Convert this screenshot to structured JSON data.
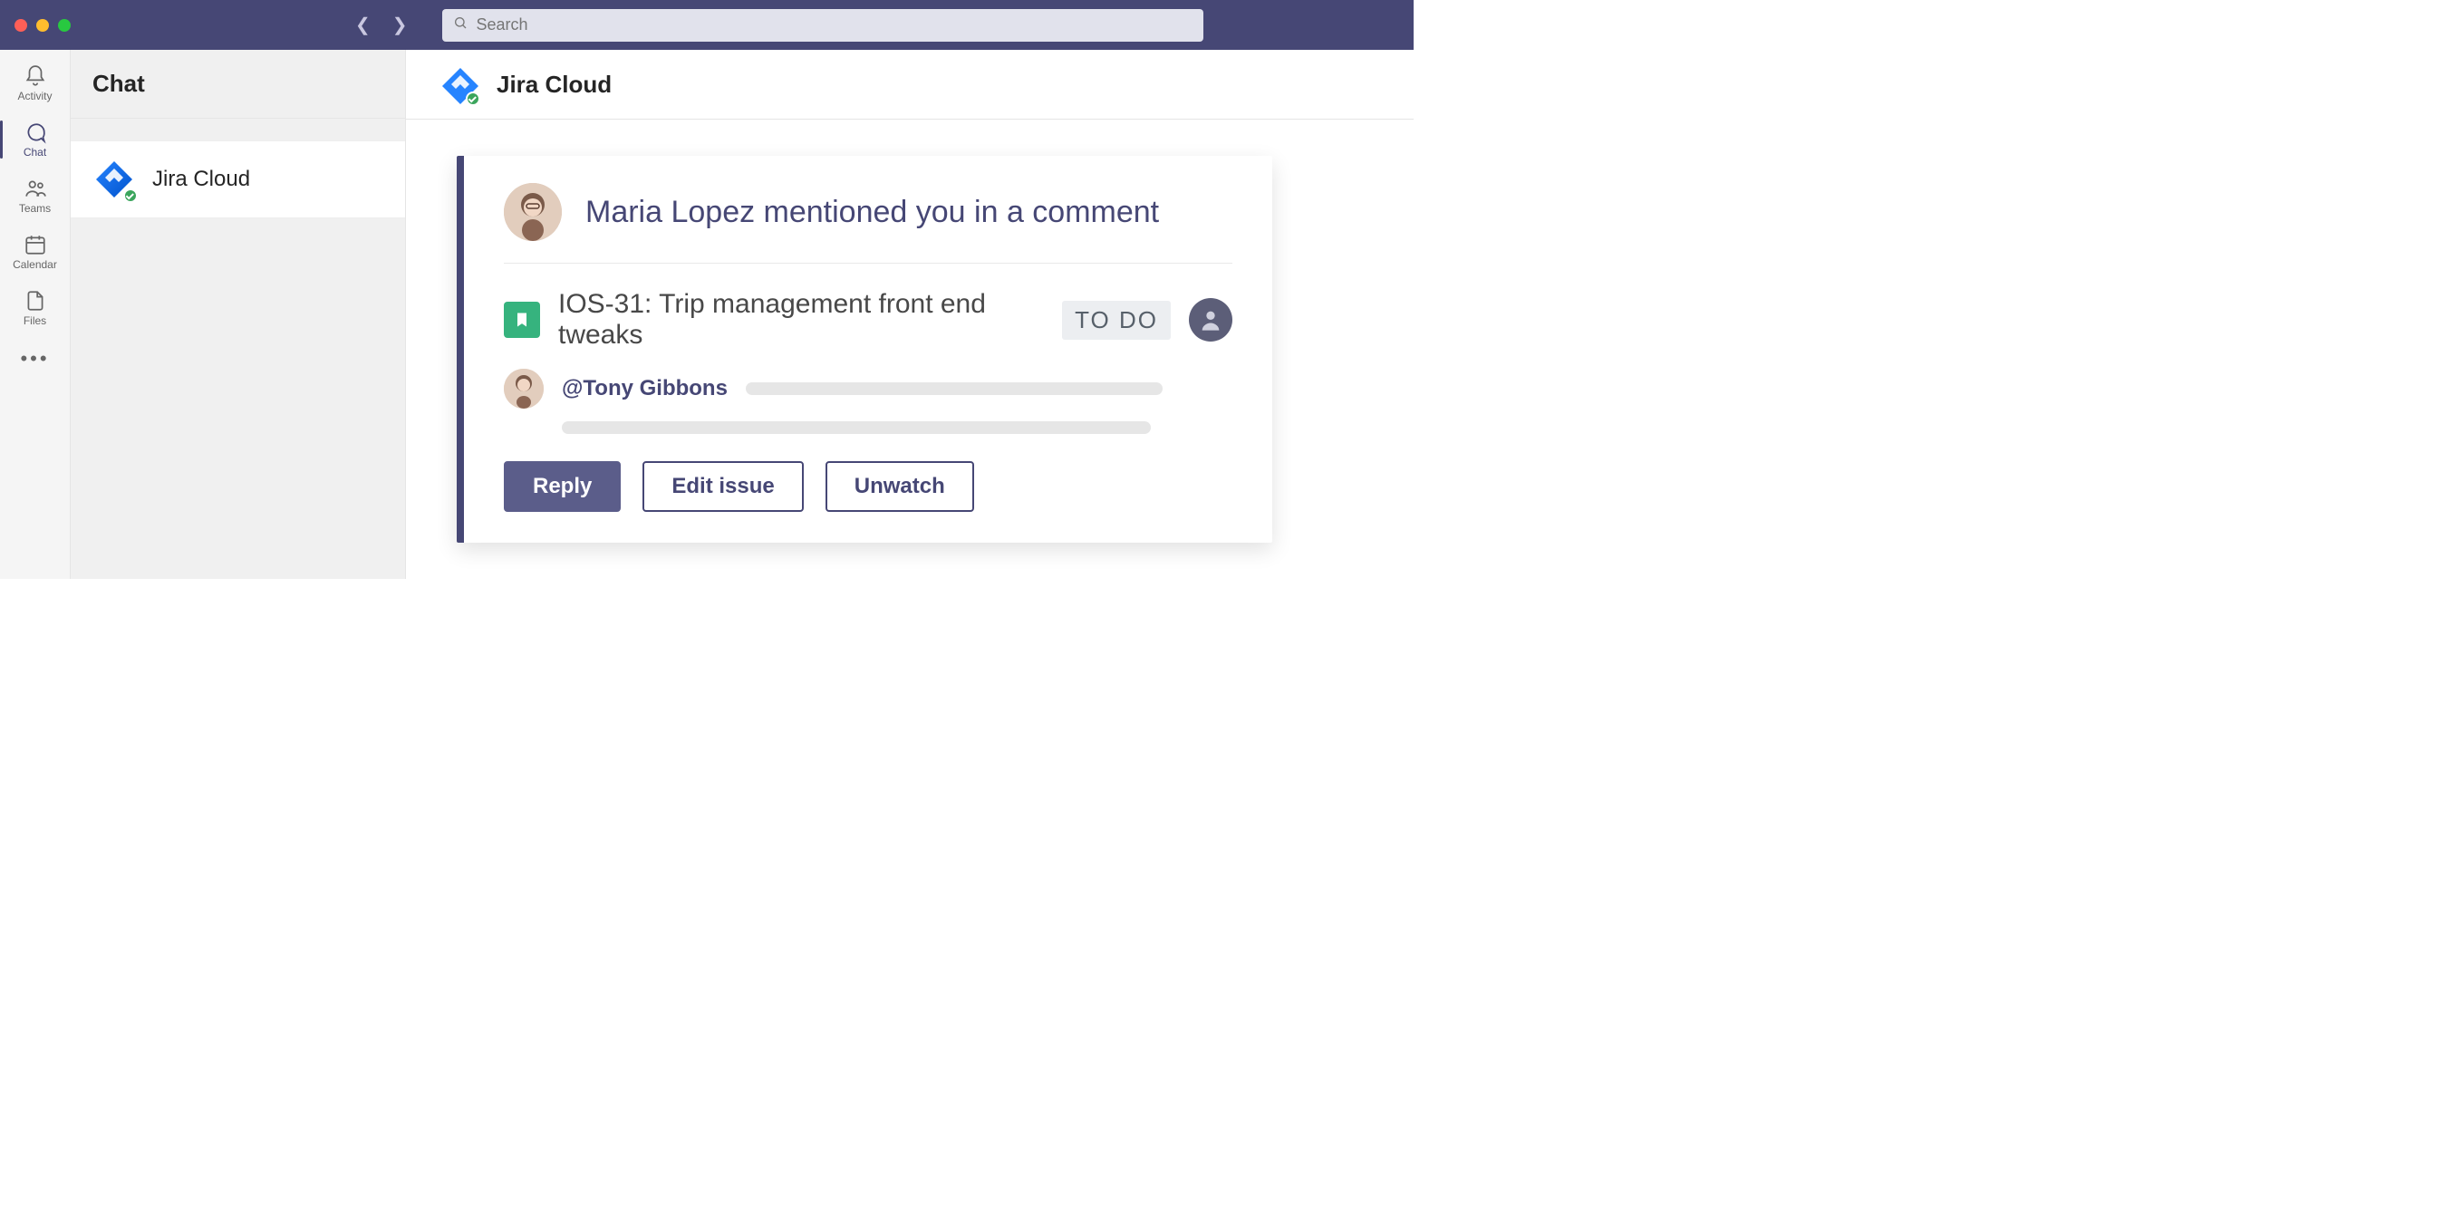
{
  "search": {
    "placeholder": "Search"
  },
  "rail": {
    "activity": "Activity",
    "chat": "Chat",
    "teams": "Teams",
    "calendar": "Calendar",
    "files": "Files"
  },
  "chatcol": {
    "header": "Chat",
    "items": [
      {
        "title": "Jira Cloud"
      }
    ]
  },
  "conv": {
    "title": "Jira Cloud"
  },
  "card": {
    "headline": "Maria Lopez mentioned you in a comment",
    "issue": {
      "key_title": "IOS-31: Trip management front end tweaks",
      "status": "TO DO"
    },
    "mention": "@Tony Gibbons",
    "actions": {
      "reply": "Reply",
      "edit": "Edit issue",
      "unwatch": "Unwatch"
    }
  }
}
